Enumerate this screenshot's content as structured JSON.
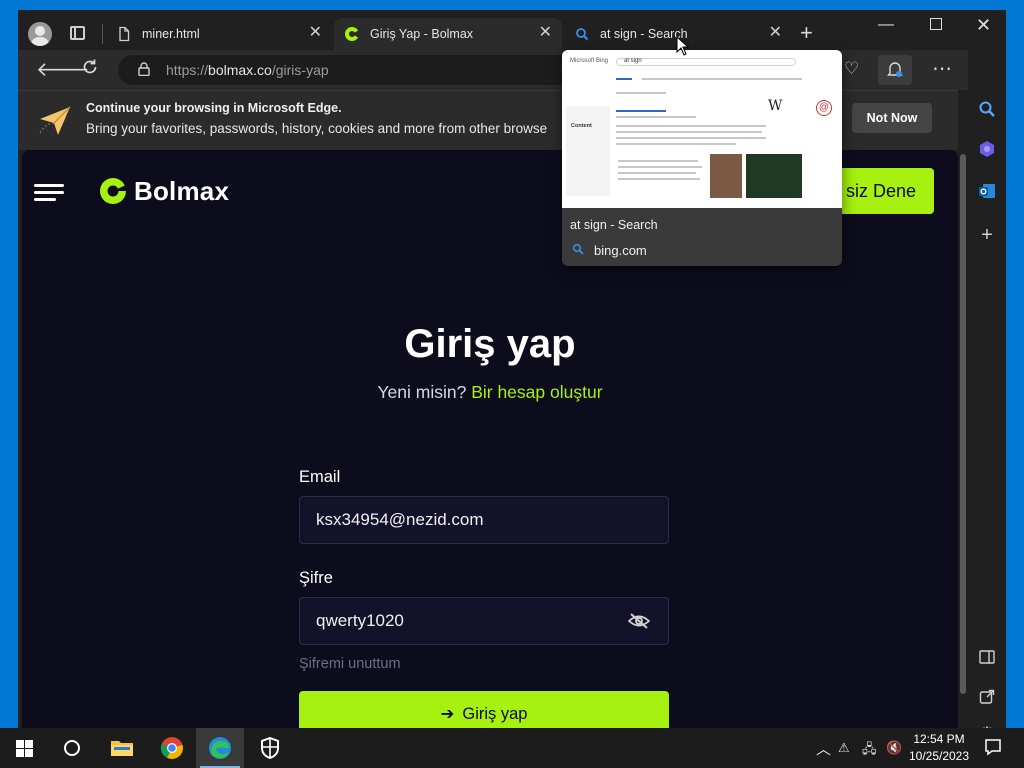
{
  "browser": {
    "tabs": [
      {
        "label": "miner.html",
        "active": false
      },
      {
        "label": "Giriş Yap - Bolmax",
        "active": true
      },
      {
        "label": "at sign - Search",
        "active": false
      }
    ],
    "address": {
      "prefix": "https://",
      "domain": "bolmax.co",
      "path": "/giris-yap"
    },
    "infobar": {
      "title": "Continue your browsing in Microsoft Edge.",
      "text": "Bring your favorites, passwords, history, cookies and more from other browse",
      "button": "Not Now"
    },
    "preview": {
      "title": "at sign - Search",
      "site": "bing.com",
      "thumb": {
        "brand": "Microsoft Bing",
        "query": "at sign",
        "wiki_mark": "W",
        "at_mark": "@",
        "content_label": "Content"
      }
    }
  },
  "site": {
    "brand": "Bolmax",
    "cta": "siz Dene",
    "heading": "Giriş yap",
    "subline_prefix": "Yeni misin?",
    "subline_link": "Bir hesap oluştur",
    "email_label": "Email",
    "email_value": "ksx34954@nezid.com",
    "password_label": "Şifre",
    "password_value": "qwerty1020",
    "forgot": "Şifremi unuttum",
    "submit_arrow": "➔",
    "submit": "Giriş yap",
    "accent": "#a6f10f",
    "background": "#0d0c1d"
  },
  "taskbar": {
    "time": "12:54 PM",
    "date": "10/25/2023"
  }
}
